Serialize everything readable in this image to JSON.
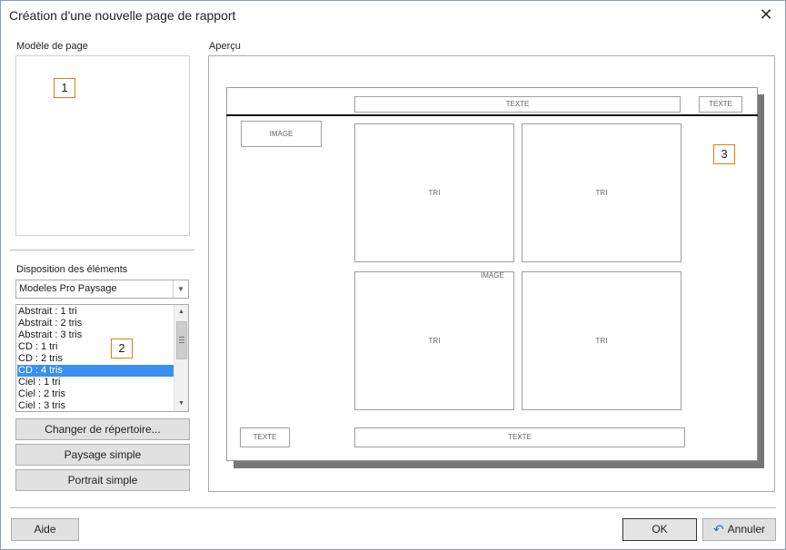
{
  "window": {
    "title": "Création d'une nouvelle page de rapport",
    "close_icon": "close-icon"
  },
  "left": {
    "model_label": "Modèle de page",
    "marker1": "1",
    "layout_label": "Disposition des éléments",
    "select_value": "Modeles Pro Paysage",
    "list_items": [
      "Abstrait : 1 tri",
      "Abstrait : 2 tris",
      "Abstrait : 3 tris",
      "CD : 1 tri",
      "CD : 2 tris",
      "CD : 4 tris",
      "Ciel : 1 tri",
      "Ciel : 2 tris",
      "Ciel : 3 tris"
    ],
    "selected_index": 5,
    "marker2": "2",
    "btn_change_dir": "Changer de répertoire...",
    "btn_landscape": "Paysage simple",
    "btn_portrait": "Portrait simple"
  },
  "preview": {
    "label": "Aperçu",
    "marker3": "3",
    "header_text_center": "TEXTE",
    "header_text_right": "TEXTE",
    "image_top": "IMAGE",
    "tri_1": "TRI",
    "tri_2": "TRI",
    "tri_3": "TRI",
    "tri_4": "TRI",
    "image_inner": "IMAGE",
    "footer_text_left": "TEXTE",
    "footer_text_center": "TEXTE"
  },
  "footer": {
    "help_label": "Aide",
    "ok_label": "OK",
    "cancel_label": "Annuler",
    "cancel_icon": "undo-icon"
  }
}
